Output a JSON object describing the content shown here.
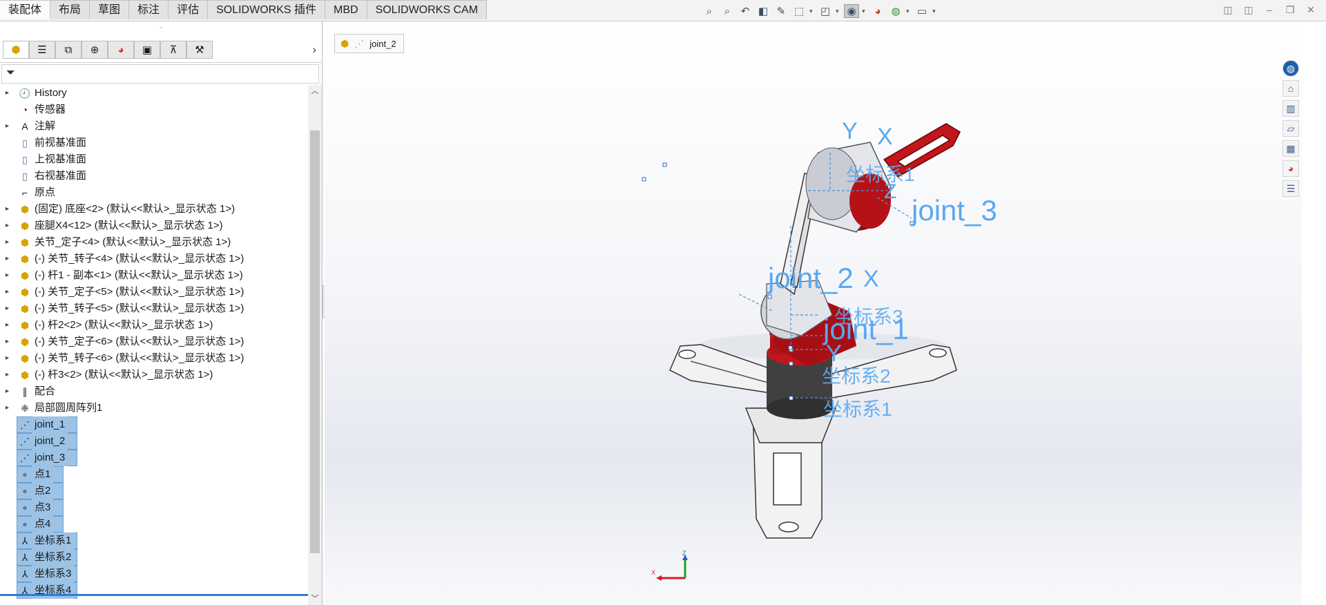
{
  "command_tabs": [
    {
      "label": "装配体",
      "active": true
    },
    {
      "label": "布局"
    },
    {
      "label": "草图"
    },
    {
      "label": "标注"
    },
    {
      "label": "评估"
    },
    {
      "label": "SOLIDWORKS 插件"
    },
    {
      "label": "MBD"
    },
    {
      "label": "SOLIDWORKS CAM"
    }
  ],
  "view_toolbar": {
    "icons": [
      "zoom-to-fit-icon",
      "zoom-to-area-icon",
      "previous-view-icon",
      "section-view-icon",
      "dynamic-annotation-icon",
      "view-orientation-icon",
      "display-style-icon",
      "hide-show-items-icon",
      "edit-appearance-icon",
      "apply-scene-icon",
      "view-settings-icon"
    ]
  },
  "feature_tree": {
    "items": [
      {
        "label": "History",
        "icon": "history-icon",
        "expandable": true
      },
      {
        "label": "传感器",
        "icon": "sensor-icon",
        "expandable": false
      },
      {
        "label": "注解",
        "icon": "annotation-icon",
        "expandable": true
      },
      {
        "label": "前视基准面",
        "icon": "plane-icon",
        "expandable": false
      },
      {
        "label": "上视基准面",
        "icon": "plane-icon",
        "expandable": false
      },
      {
        "label": "右视基准面",
        "icon": "plane-icon",
        "expandable": false
      },
      {
        "label": "原点",
        "icon": "origin-icon",
        "expandable": false
      },
      {
        "label": "(固定) 底座<2> (默认<<默认>_显示状态 1>)",
        "icon": "part-icon",
        "expandable": true
      },
      {
        "label": "座腿X4<12> (默认<<默认>_显示状态 1>)",
        "icon": "part-icon",
        "expandable": true
      },
      {
        "label": "关节_定子<4> (默认<<默认>_显示状态 1>)",
        "icon": "part-icon",
        "expandable": true
      },
      {
        "label": "(-) 关节_转子<4> (默认<<默认>_显示状态 1>)",
        "icon": "part-icon",
        "expandable": true
      },
      {
        "label": "(-) 杆1 - 副本<1> (默认<<默认>_显示状态 1>)",
        "icon": "part-icon",
        "expandable": true
      },
      {
        "label": "(-) 关节_定子<5> (默认<<默认>_显示状态 1>)",
        "icon": "part-icon",
        "expandable": true
      },
      {
        "label": "(-) 关节_转子<5> (默认<<默认>_显示状态 1>)",
        "icon": "part-icon",
        "expandable": true
      },
      {
        "label": "(-) 杆2<2> (默认<<默认>_显示状态 1>)",
        "icon": "part-icon",
        "expandable": true
      },
      {
        "label": "(-) 关节_定子<6> (默认<<默认>_显示状态 1>)",
        "icon": "part-icon",
        "expandable": true
      },
      {
        "label": "(-) 关节_转子<6> (默认<<默认>_显示状态 1>)",
        "icon": "part-icon",
        "expandable": true
      },
      {
        "label": "(-) 杆3<2> (默认<<默认>_显示状态 1>)",
        "icon": "part-icon",
        "expandable": true
      },
      {
        "label": "配合",
        "icon": "mates-icon",
        "expandable": true
      },
      {
        "label": "局部圆周阵列1",
        "icon": "pattern-icon",
        "expandable": true
      },
      {
        "label": "joint_1",
        "icon": "axis-icon",
        "selected": true
      },
      {
        "label": "joint_2",
        "icon": "axis-icon",
        "selected": true
      },
      {
        "label": "joint_3",
        "icon": "axis-icon",
        "selected": true
      },
      {
        "label": "点1",
        "icon": "point-icon",
        "selected": true
      },
      {
        "label": "点2",
        "icon": "point-icon",
        "selected": true
      },
      {
        "label": "点3",
        "icon": "point-icon",
        "selected": true
      },
      {
        "label": "点4",
        "icon": "point-icon",
        "selected": true
      },
      {
        "label": "坐标系1",
        "icon": "coordinate-system-icon",
        "selected": true
      },
      {
        "label": "坐标系2",
        "icon": "coordinate-system-icon",
        "selected": true
      },
      {
        "label": "坐标系3",
        "icon": "coordinate-system-icon",
        "selected": true
      },
      {
        "label": "坐标系4",
        "icon": "coordinate-system-icon",
        "selected": true
      }
    ]
  },
  "breadcrumb": {
    "item": "joint_2"
  },
  "viewport_labels": {
    "joint_1": "joint_1",
    "joint_2": "joint_2",
    "joint_3": "joint_3",
    "cs1": "坐标系1",
    "cs2": "坐标系2",
    "cs3": "坐标系3",
    "cs4": "坐标系1",
    "x": "X",
    "y": "Y",
    "z": "Z"
  },
  "triad": {
    "x": "X",
    "z": "Z"
  },
  "colors": {
    "accent_red": "#c0161c",
    "label_blue": "#5aa8f0",
    "selection": "#9cc3e6"
  }
}
